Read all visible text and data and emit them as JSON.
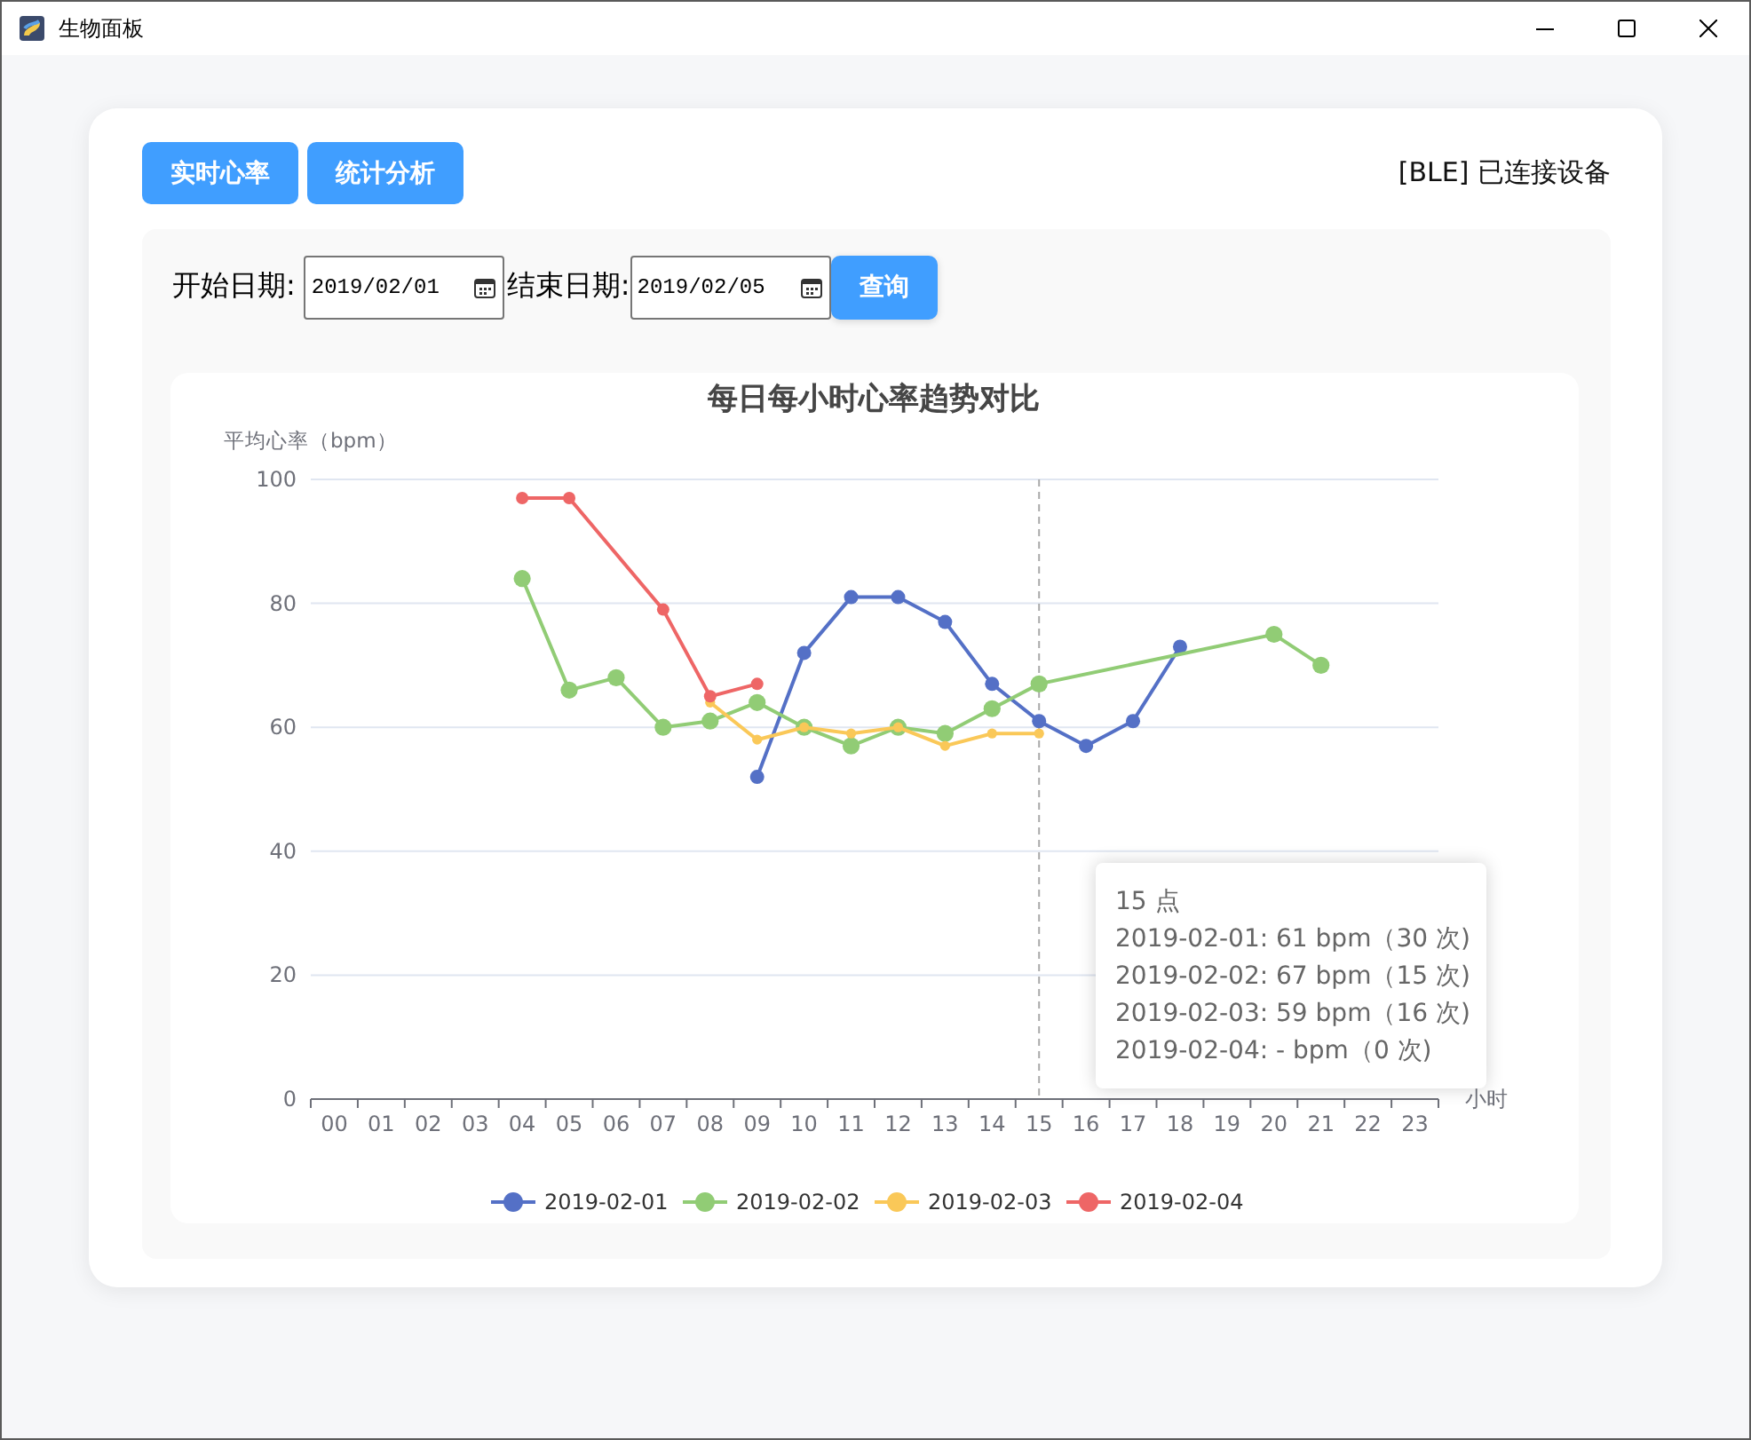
{
  "window": {
    "title": "生物面板"
  },
  "tabs": [
    {
      "label": "实时心率"
    },
    {
      "label": "统计分析"
    }
  ],
  "status": "[BLE] 已连接设备",
  "filters": [
    {
      "label": "开始日期:",
      "value": "2019/02/01"
    },
    {
      "label": "结束日期:",
      "value": "2019/02/05"
    }
  ],
  "query_button": "查询",
  "chart": {
    "chart_data": {
      "type": "line",
      "title": "每日每小时心率趋势对比",
      "ylabel": "平均心率（bpm）",
      "xlabel": "小时",
      "categories": [
        "00",
        "01",
        "02",
        "03",
        "04",
        "05",
        "06",
        "07",
        "08",
        "09",
        "10",
        "11",
        "12",
        "13",
        "14",
        "15",
        "16",
        "17",
        "18",
        "19",
        "20",
        "21",
        "22",
        "23"
      ],
      "ylim": [
        0,
        100
      ],
      "yticks": [
        0,
        20,
        40,
        60,
        80,
        100
      ],
      "grid": true,
      "legend": true,
      "ref_lines": [
        {
          "axis": "x",
          "value": "15"
        }
      ],
      "series": [
        {
          "name": "2019-02-01",
          "color": "#5470c6",
          "marker": "circle",
          "values": [
            null,
            null,
            null,
            null,
            null,
            null,
            null,
            null,
            null,
            52,
            72,
            81,
            81,
            77,
            67,
            61,
            57,
            61,
            73,
            null,
            null,
            null,
            null,
            null
          ]
        },
        {
          "name": "2019-02-02",
          "color": "#91cc75",
          "marker": "circle",
          "values": [
            null,
            null,
            null,
            null,
            84,
            66,
            68,
            60,
            61,
            64,
            60,
            57,
            60,
            59,
            63,
            67,
            null,
            null,
            null,
            null,
            75,
            70,
            null,
            null
          ]
        },
        {
          "name": "2019-02-03",
          "color": "#fac858",
          "marker": "circle",
          "values": [
            null,
            null,
            null,
            null,
            null,
            null,
            null,
            null,
            64,
            58,
            60,
            59,
            60,
            57,
            59,
            59,
            null,
            null,
            null,
            null,
            null,
            null,
            null,
            null
          ]
        },
        {
          "name": "2019-02-04",
          "color": "#ee6666",
          "marker": "circle",
          "values": [
            null,
            null,
            null,
            null,
            97,
            97,
            null,
            79,
            65,
            67,
            null,
            null,
            null,
            null,
            null,
            null,
            null,
            null,
            null,
            null,
            null,
            null,
            null,
            null
          ]
        }
      ]
    },
    "tooltip": {
      "title": "15 点",
      "lines": [
        "2019-02-01: 61 bpm（30 次)",
        "2019-02-02: 67 bpm（15 次)",
        "2019-02-03: 59 bpm（16 次)",
        "2019-02-04: - bpm（0 次)"
      ]
    }
  }
}
